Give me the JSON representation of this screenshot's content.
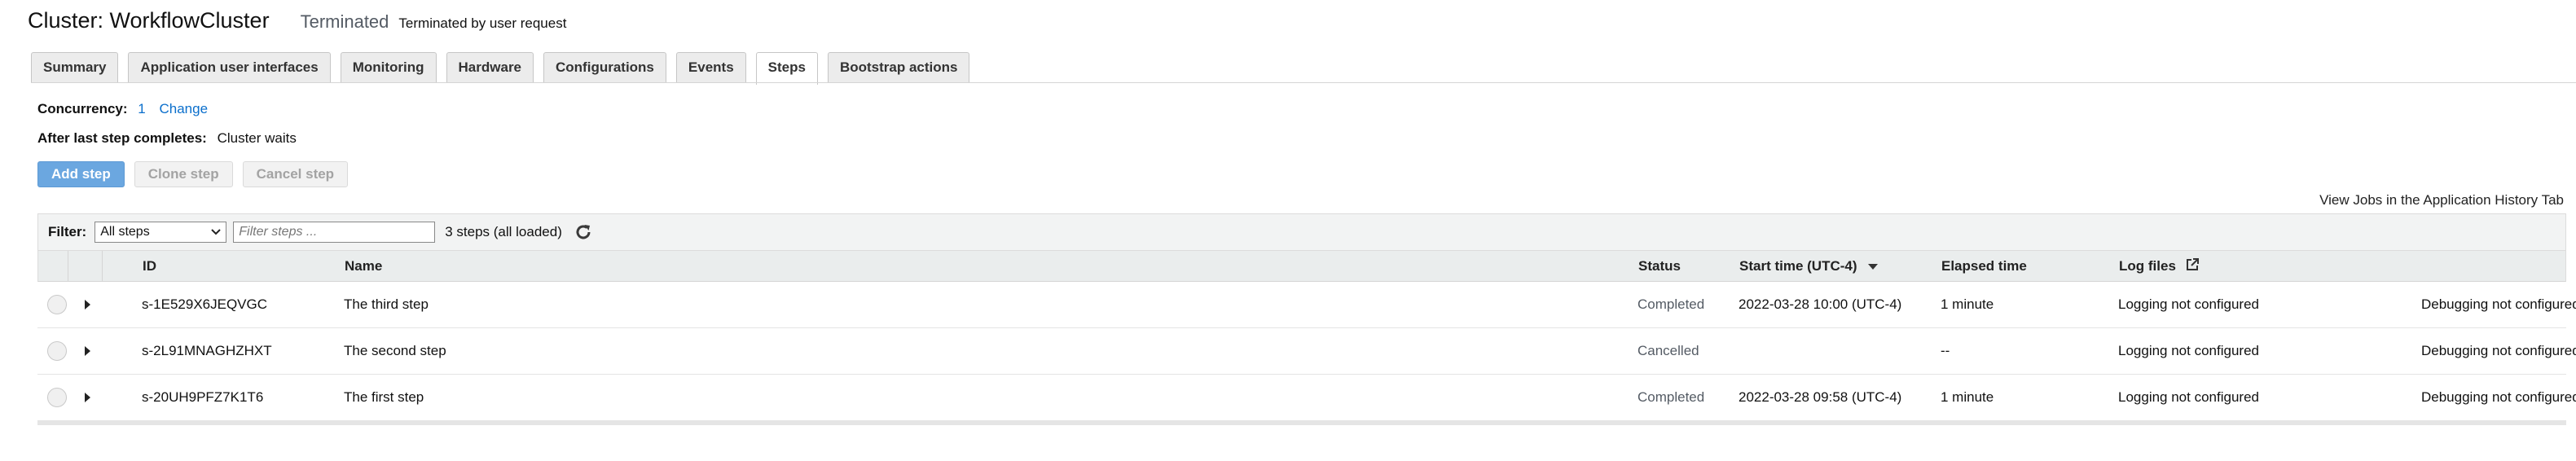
{
  "header": {
    "cluster_title": "Cluster: WorkflowCluster",
    "state": "Terminated",
    "state_reason": "Terminated by user request"
  },
  "tabs": [
    {
      "label": "Summary",
      "active": false
    },
    {
      "label": "Application user interfaces",
      "active": false
    },
    {
      "label": "Monitoring",
      "active": false
    },
    {
      "label": "Hardware",
      "active": false
    },
    {
      "label": "Configurations",
      "active": false
    },
    {
      "label": "Events",
      "active": false
    },
    {
      "label": "Steps",
      "active": true
    },
    {
      "label": "Bootstrap actions",
      "active": false
    }
  ],
  "concurrency": {
    "label": "Concurrency:",
    "value": "1",
    "change_link": "Change"
  },
  "after_last_step": {
    "label": "After last step completes:",
    "value": "Cluster waits"
  },
  "actions": {
    "add_step": "Add step",
    "clone_step": "Clone step",
    "cancel_step": "Cancel step"
  },
  "history_link": "View Jobs in the Application History Tab",
  "filter": {
    "label": "Filter:",
    "selected": "All steps",
    "placeholder": "Filter steps ...",
    "count": "3 steps (all loaded)"
  },
  "columns": {
    "id": "ID",
    "name": "Name",
    "status": "Status",
    "start_time": "Start time (UTC-4)",
    "elapsed_time": "Elapsed time",
    "log_files": "Log files"
  },
  "rows": [
    {
      "id": "s-1E529X6JEQVGC",
      "name": "The third step",
      "status": "Completed",
      "start_time": "2022-03-28 10:00 (UTC-4)",
      "elapsed": "1 minute",
      "logs": "Logging not configured",
      "debug": "Debugging not configured"
    },
    {
      "id": "s-2L91MNAGHZHXT",
      "name": "The second step",
      "status": "Cancelled",
      "start_time": "",
      "elapsed": "--",
      "logs": "Logging not configured",
      "debug": "Debugging not configured"
    },
    {
      "id": "s-20UH9PFZ7K1T6",
      "name": "The first step",
      "status": "Completed",
      "start_time": "2022-03-28 09:58 (UTC-4)",
      "elapsed": "1 minute",
      "logs": "Logging not configured",
      "debug": "Debugging not configured"
    }
  ],
  "colors": {
    "link": "#0b6fcc",
    "primary_button": "#6ba7e0",
    "header_bg": "#eaeded"
  },
  "icons": {
    "refresh": "refresh-icon",
    "sort": "sort-desc-icon",
    "external": "external-link-icon",
    "expand": "expand-caret-icon"
  }
}
